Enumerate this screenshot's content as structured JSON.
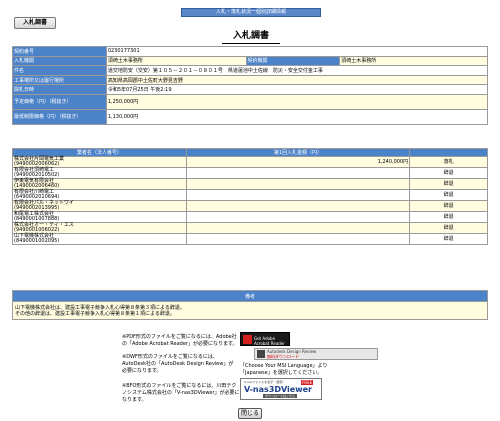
{
  "topbar": {
    "title": "入札・落札状況一個別詳細情報"
  },
  "kind_label": "入札調書",
  "page_title": "入札調書",
  "info": {
    "rows": [
      {
        "label": "契約番号",
        "value": "0230177301"
      },
      {
        "label": "入札機関",
        "value": "須崎土木事務所",
        "label2": "契約機関",
        "value2": "須崎土木事務所"
      },
      {
        "label": "件名",
        "value": "道交地防安（交安）第１０５－２０１－０８０１号　県道蓮池中土佐線　防災・安全交付金工事"
      },
      {
        "label": "工事場所又は履行場所",
        "value": "高知県高岡郡中土佐町大野見吉野"
      },
      {
        "label": "開札日時",
        "value": "令和5年07月25日 午後2:19"
      },
      {
        "label": "予定価格（円）（税抜き）",
        "value": "1,250,000円"
      },
      {
        "label": "最低制限価格（円）（税抜き）",
        "value": "1,130,000円"
      }
    ]
  },
  "bids": {
    "headers": [
      "業者名（法人番号）",
      "第1回入札金額（円）",
      ""
    ],
    "rows": [
      {
        "name": "株式会社片岡電気工業",
        "number": "(9490002006062)",
        "amount": "1,240,000円",
        "status": "落札"
      },
      {
        "name": "有限会社須崎電工",
        "number": "(9490002010502)",
        "amount": "",
        "status": "辞退"
      },
      {
        "name": "伊東電気有限会社",
        "number": "(1490002006460)",
        "amount": "",
        "status": "辞退"
      },
      {
        "name": "有限会社川崎電工",
        "number": "(6490002010694)",
        "amount": "",
        "status": "辞退"
      },
      {
        "name": "有限会社パル・ネットワイ",
        "number": "(9490002013995)",
        "amount": "",
        "status": "辞退"
      },
      {
        "name": "和尾電工株式会社",
        "number": "(8490001007888)",
        "amount": "",
        "status": "辞退"
      },
      {
        "name": "株式会社オー・ティ・エス",
        "number": "(9490001006022)",
        "amount": "",
        "status": "辞退"
      },
      {
        "name": "山下電機株式会社",
        "number": "(8490001002095)",
        "amount": "",
        "status": "辞退"
      }
    ]
  },
  "remarks": {
    "header": "備考",
    "line1": "山下電機株式会社は、建設工事電子競争入札心得第８条第３項による辞退。",
    "line2": "その他の辞退は、建設工事電子競争入札心得第８条第１項による辞退。"
  },
  "notices": {
    "pdf": "※PDF形式のファイルをご覧になるには、Adobe社の「Adobe Acrobat Reader」が必要になります。",
    "dwf": "※DWF形式のファイルをご覧になるには、AutoDesk社の「AutoDesk Design Review」が必要になります。",
    "dwf_extra": "「Choose Your MSI Language」より「Japanese」を選択してください。",
    "bfo": "※BFO形式のファイルをご覧になるには、川田テクノシステム株式会社の「V-nas3DViewer」が必要になります。"
  },
  "badges": {
    "adobe": "Get Adobe Acrobat Reader",
    "autodesk_title": "Autodesk Design Review",
    "autodesk_sub": "無料ダウンロード",
    "vnas_top": "V-nasファイルを表示・閲覧！",
    "vnas_name": "V-nas3DViewer",
    "vnas_free": "FREE",
    "vnas_sub": "ダウンロードはこちら"
  },
  "close_label": "閉じる",
  "colors": {
    "header_blue": "#4b82c8",
    "row_yellow": "#fffce0"
  }
}
